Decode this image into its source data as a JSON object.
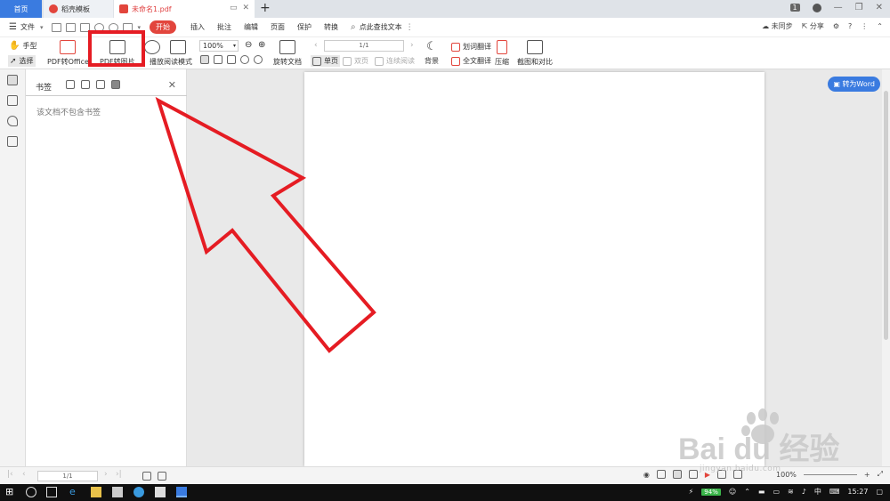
{
  "tabs": {
    "home": "首页",
    "template": "稻壳模板",
    "document": "未命名1.pdf",
    "add": "+"
  },
  "window": {
    "badge": "1"
  },
  "menu": {
    "file": "文件",
    "items": [
      "开始",
      "插入",
      "批注",
      "编辑",
      "页面",
      "保护",
      "转换"
    ],
    "search": "点此查找文本",
    "sync": "未同步",
    "share": "分享"
  },
  "ribbon": {
    "hand": "手型",
    "select": "选择",
    "pdf_to_office": "PDF转Office",
    "pdf_to_image": "PDF转图片",
    "play": "播放",
    "read_mode": "阅读模式",
    "zoom": "100%",
    "rotate_doc": "旋转文档",
    "page_indicator": "1/1",
    "single_page": "单页",
    "double_page": "双页",
    "continuous": "连续阅读",
    "background": "背景",
    "word_translate": "划词翻译",
    "full_translate": "全文翻译",
    "compress": "压缩",
    "screenshot_compare": "截图和对比"
  },
  "bookmarks": {
    "title": "书签",
    "empty": "该文档不包含书签"
  },
  "doc": {
    "to_word": "转为Word"
  },
  "status": {
    "page": "1/1",
    "zoom": "100%"
  },
  "taskbar": {
    "battery": "94%",
    "ime": "中",
    "time": "15:27"
  },
  "watermark": {
    "brand": "Bai du 经验",
    "site": "jingyan.baidu.com"
  },
  "colors": {
    "accent": "#3a7be0",
    "start_tab": "#e2453c",
    "annotation": "#e51c23"
  }
}
